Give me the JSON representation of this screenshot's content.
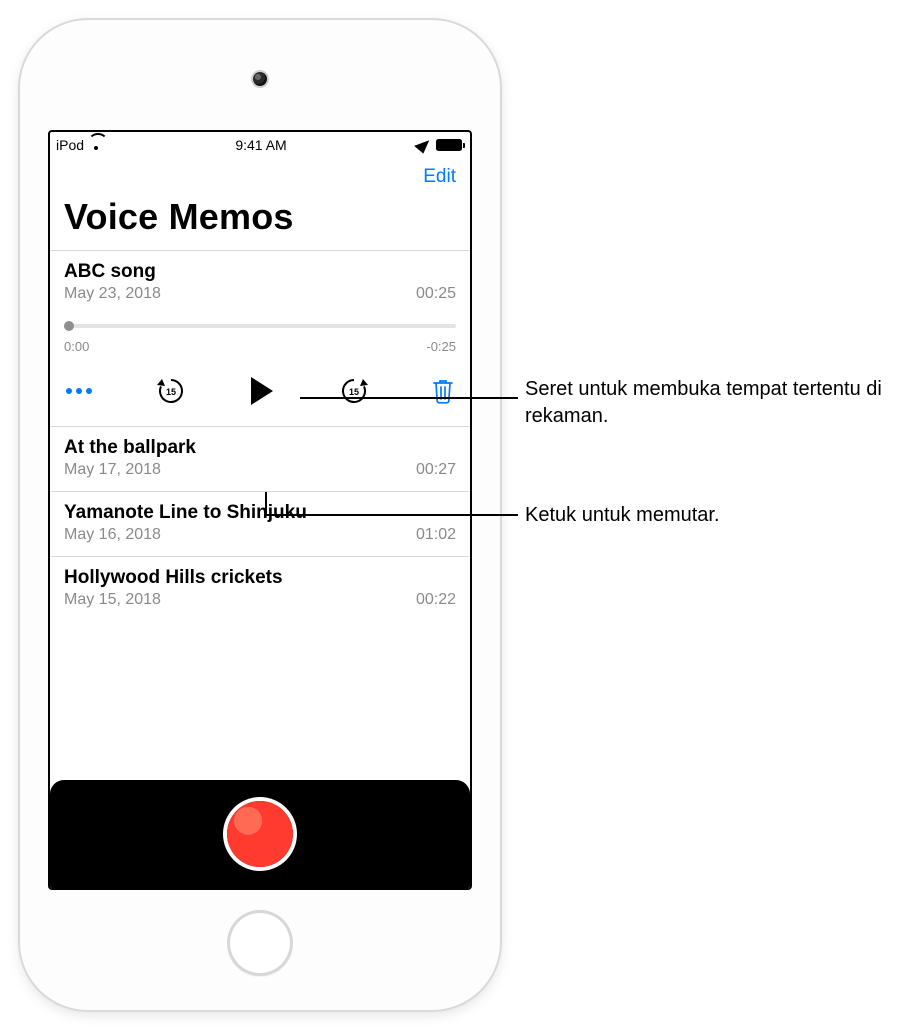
{
  "status": {
    "carrier": "iPod",
    "time": "9:41 AM"
  },
  "nav": {
    "edit": "Edit"
  },
  "title": "Voice Memos",
  "selected": {
    "name": "ABC song",
    "date": "May 23, 2018",
    "duration": "00:25",
    "elapsed": "0:00",
    "remaining": "-0:25",
    "skip_seconds": "15"
  },
  "memos": [
    {
      "name": "At the ballpark",
      "date": "May 17, 2018",
      "duration": "00:27"
    },
    {
      "name": "Yamanote Line to Shinjuku",
      "date": "May 16, 2018",
      "duration": "01:02"
    },
    {
      "name": "Hollywood Hills crickets",
      "date": "May 15, 2018",
      "duration": "00:22"
    }
  ],
  "callouts": {
    "scrub": "Seret untuk membuka tempat tertentu di rekaman.",
    "play": "Ketuk untuk memutar."
  }
}
